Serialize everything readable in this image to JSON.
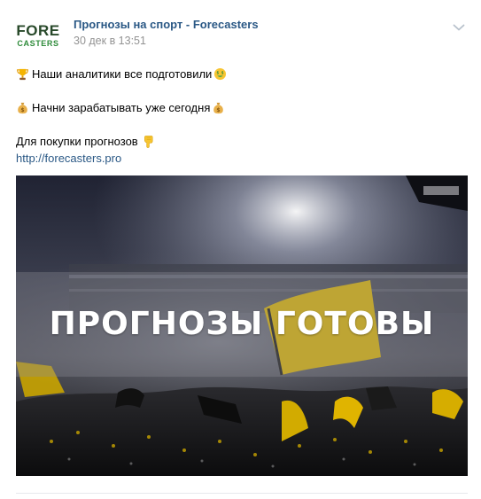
{
  "post": {
    "author": "Прогнозы на спорт - Forecasters",
    "date": "30 дек в 13:51",
    "avatar": {
      "line1": "FORE",
      "line2": "CASTERS"
    },
    "lines": {
      "line1": "Наши аналитики все подготовили",
      "line2": "Начни зарабатывать уже сегодня",
      "line3": "Для покупки прогнозов",
      "link": "http://forecasters.pro"
    },
    "image": {
      "caption": "ПРОГНОЗЫ ГОТОВЫ"
    }
  },
  "icons": {
    "avatar": "forecasters-logo",
    "menu": "chevron-down-icon",
    "emoji_1": "trophy-icon",
    "emoji_2": "money-mouth-face-icon",
    "emoji_3": "money-bag-icon",
    "emoji_4": "money-bag-icon",
    "emoji_5": "pointing-down-icon"
  },
  "colors": {
    "author": "#2a5885",
    "date": "#939393",
    "link": "#2a5885",
    "logo_dark": "#28492a",
    "logo_green": "#2e8b3a",
    "divider": "#e7e8ec"
  }
}
